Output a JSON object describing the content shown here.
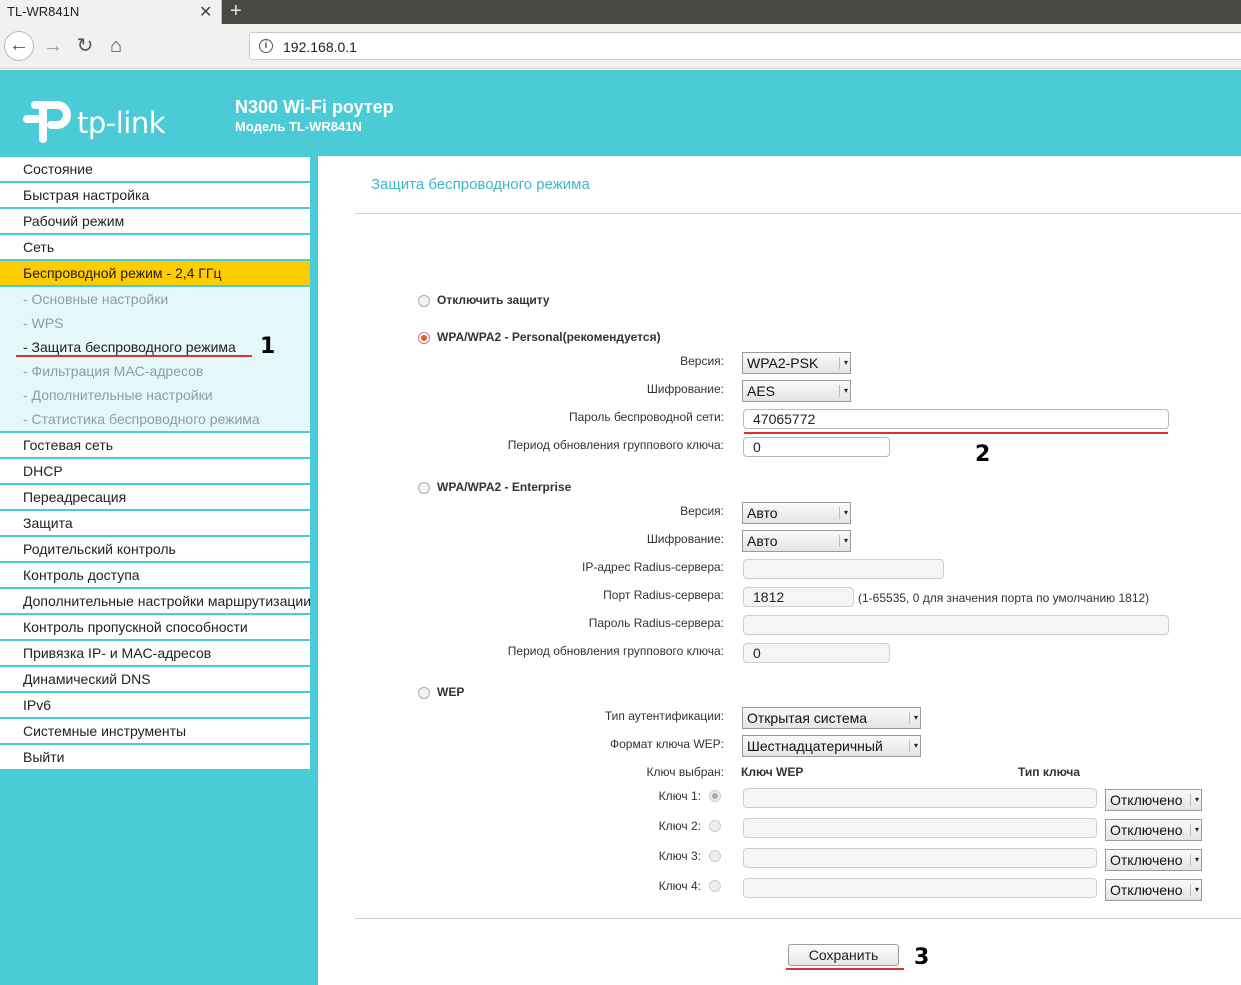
{
  "browser": {
    "tab_title": "TL-WR841N",
    "close_glyph": "✕",
    "new_tab_glyph": "+",
    "url": "192.168.0.1",
    "back_glyph": "←",
    "forward_glyph": "→",
    "reload_glyph": "↻",
    "home_glyph": "⌂"
  },
  "header": {
    "logo_text": "tp-link",
    "product_title": "N300 Wi-Fi роутер",
    "model": "Модель TL-WR841N",
    "bg_color": "#4acbd6"
  },
  "sidebar": {
    "items_top": [
      {
        "label": "Состояние"
      },
      {
        "label": "Быстрая настройка"
      },
      {
        "label": "Рабочий режим"
      },
      {
        "label": "Сеть"
      }
    ],
    "active_item": "Беспроводной режим - 2,4 ГГц",
    "sub_items": [
      {
        "label": "- Основные настройки"
      },
      {
        "label": "- WPS"
      },
      {
        "label": "- Защита беспроводного режима"
      },
      {
        "label": "- Фильтрация MAC-адресов"
      },
      {
        "label": "- Дополнительные настройки"
      },
      {
        "label": "- Статистика беспроводного режима"
      }
    ],
    "items_bottom": [
      {
        "label": "Гостевая сеть"
      },
      {
        "label": "DHCP"
      },
      {
        "label": "Переадресация"
      },
      {
        "label": "Защита"
      },
      {
        "label": "Родительский контроль"
      },
      {
        "label": "Контроль доступа"
      },
      {
        "label": "Дополнительные настройки маршрутизации"
      },
      {
        "label": "Контроль пропускной способности"
      },
      {
        "label": "Привязка IP- и MAC-адресов"
      },
      {
        "label": "Динамический DNS"
      },
      {
        "label": "IPv6"
      },
      {
        "label": "Системные инструменты"
      },
      {
        "label": "Выйти"
      }
    ],
    "active_color": "#ffcc00"
  },
  "annotations": {
    "n1": "1",
    "n2": "2",
    "n3": "3",
    "line_color": "#e03030"
  },
  "page": {
    "title": "Защита беспроводного режима",
    "disable_option": "Отключить защиту",
    "personal": {
      "label": "WPA/WPA2 - Personal(рекомендуется)",
      "selected": true,
      "version_label": "Версия:",
      "version_value": "WPA2-PSK",
      "encryption_label": "Шифрование:",
      "encryption_value": "AES",
      "password_label": "Пароль беспроводной сети:",
      "password_value": "47065772",
      "group_key_label": "Период обновления группового ключа:",
      "group_key_value": "0"
    },
    "enterprise": {
      "label": "WPA/WPA2 - Enterprise",
      "version_label": "Версия:",
      "version_value": "Авто",
      "encryption_label": "Шифрование:",
      "encryption_value": "Авто",
      "radius_ip_label": "IP-адрес Radius-сервера:",
      "radius_ip_value": "",
      "radius_port_label": "Порт Radius-сервера:",
      "radius_port_value": "1812",
      "radius_port_hint": "(1-65535, 0 для значения порта по умолчанию 1812)",
      "radius_pass_label": "Пароль Radius-сервера:",
      "radius_pass_value": "",
      "group_key_label": "Период обновления группового ключа:",
      "group_key_value": "0"
    },
    "wep": {
      "label": "WEP",
      "auth_label": "Тип аутентификации:",
      "auth_value": "Открытая система",
      "format_label": "Формат ключа WEP:",
      "format_value": "Шестнадцатеричный",
      "key_selected_label": "Ключ выбран:",
      "key_col_header": "Ключ WEP",
      "type_col_header": "Тип ключа",
      "keys": [
        {
          "label": "Ключ 1:",
          "value": "",
          "type": "Отключено",
          "selected": true
        },
        {
          "label": "Ключ 2:",
          "value": "",
          "type": "Отключено",
          "selected": false
        },
        {
          "label": "Ключ 3:",
          "value": "",
          "type": "Отключено",
          "selected": false
        },
        {
          "label": "Ключ 4:",
          "value": "",
          "type": "Отключено",
          "selected": false
        }
      ]
    },
    "save_button": "Сохранить",
    "arrow_glyph": "▾"
  }
}
